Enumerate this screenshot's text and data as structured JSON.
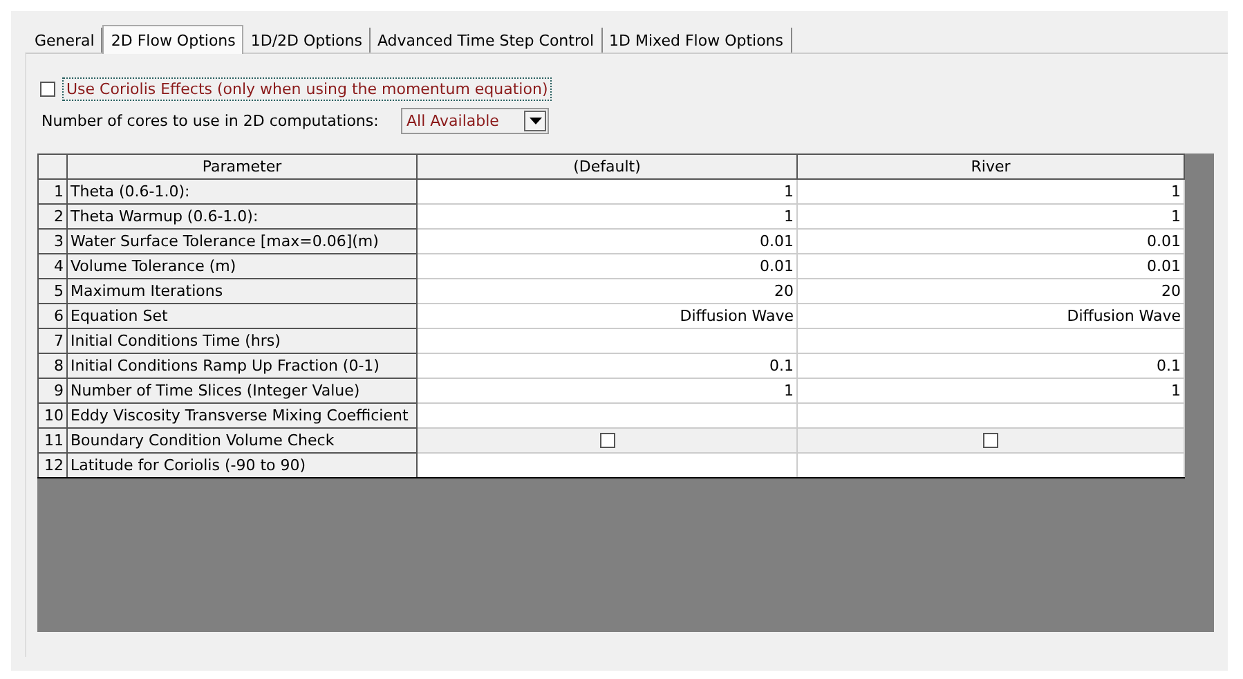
{
  "tabs": [
    {
      "label": "General",
      "selected": false
    },
    {
      "label": "2D Flow Options",
      "selected": true
    },
    {
      "label": "1D/2D Options",
      "selected": false
    },
    {
      "label": "Advanced Time Step Control",
      "selected": false
    },
    {
      "label": "1D Mixed Flow Options",
      "selected": false
    }
  ],
  "coriolis": {
    "label": "Use Coriolis Effects (only when using the momentum equation)",
    "checked": false,
    "focused": true
  },
  "cores": {
    "label": "Number of cores to use in 2D computations:",
    "value": "All Available"
  },
  "table": {
    "columns": [
      "Parameter",
      "(Default)",
      "River"
    ],
    "rows": [
      {
        "number": "1",
        "parameter": "Theta  (0.6-1.0):",
        "kind": "value",
        "values": [
          "1",
          "1"
        ]
      },
      {
        "number": "2",
        "parameter": "Theta Warmup  (0.6-1.0):",
        "kind": "value",
        "values": [
          "1",
          "1"
        ]
      },
      {
        "number": "3",
        "parameter": "Water Surface Tolerance [max=0.06](m)",
        "kind": "value",
        "values": [
          "0.01",
          "0.01"
        ]
      },
      {
        "number": "4",
        "parameter": "Volume Tolerance (m)",
        "kind": "value",
        "values": [
          "0.01",
          "0.01"
        ]
      },
      {
        "number": "5",
        "parameter": "Maximum Iterations",
        "kind": "value",
        "values": [
          "20",
          "20"
        ]
      },
      {
        "number": "6",
        "parameter": "Equation Set",
        "kind": "value",
        "values": [
          "Diffusion Wave",
          "Diffusion Wave"
        ]
      },
      {
        "number": "7",
        "parameter": "Initial Conditions Time (hrs)",
        "kind": "blank"
      },
      {
        "number": "8",
        "parameter": "Initial Conditions Ramp Up Fraction (0-1)",
        "kind": "value",
        "values": [
          "0.1",
          "0.1"
        ]
      },
      {
        "number": "9",
        "parameter": "Number of Time Slices (Integer Value)",
        "kind": "value",
        "values": [
          "1",
          "1"
        ]
      },
      {
        "number": "10",
        "parameter": "Eddy Viscosity Transverse Mixing Coefficient",
        "kind": "blank"
      },
      {
        "number": "11",
        "parameter": "Boundary Condition Volume Check",
        "kind": "checkbox",
        "checked": [
          false,
          false
        ]
      },
      {
        "number": "12",
        "parameter": "Latitude for Coriolis (-90 to 90)",
        "kind": "blank"
      }
    ]
  }
}
